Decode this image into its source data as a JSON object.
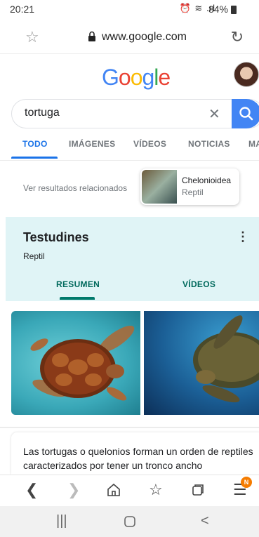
{
  "status_bar": {
    "time": "20:21",
    "icons": "⏰ ≋ .ıl",
    "battery": "84%"
  },
  "browser": {
    "url": "www.google.com",
    "star_icon": "star-icon",
    "reload_icon": "reload-icon"
  },
  "google": {
    "logo_letters": [
      "G",
      "o",
      "o",
      "g",
      "l",
      "e"
    ],
    "logo_colors": [
      "#4285f4",
      "#ea4335",
      "#fbbc05",
      "#4285f4",
      "#34a853",
      "#ea4335"
    ]
  },
  "search": {
    "query": "tortuga",
    "clear_glyph": "✕"
  },
  "tabs": [
    {
      "label": "TODO"
    },
    {
      "label": "IMÁGENES"
    },
    {
      "label": "VÍDEOS"
    },
    {
      "label": "NOTICIAS"
    },
    {
      "label": "MA"
    }
  ],
  "related": {
    "prompt": "Ver resultados relacionados",
    "card_title": "Chelonioidea",
    "card_subtitle": "Reptil"
  },
  "knowledge_panel": {
    "title": "Testudines",
    "subtitle": "Reptil",
    "more_glyph": "⋮",
    "tabs": [
      "RESUMEN",
      "VÍDEOS"
    ]
  },
  "snippet": {
    "text": "Las tortugas o quelonios forman un orden de reptiles caracterizados por tener un tronco ancho"
  },
  "browser_toolbar": {
    "tabs_badge": "N"
  },
  "colors": {
    "accent": "#1a73e8",
    "panel_bg": "#e0f4f6",
    "panel_accent": "#00796b"
  }
}
